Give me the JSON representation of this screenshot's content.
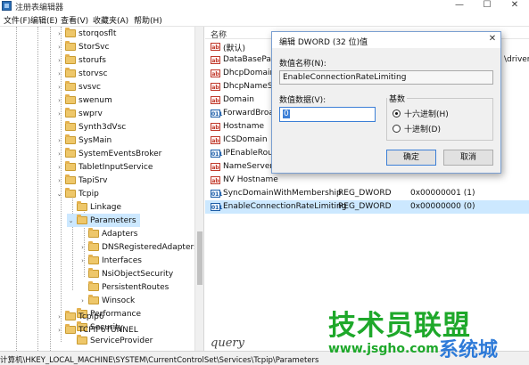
{
  "window": {
    "title": "注册表编辑器",
    "minimize": "—",
    "maximize": "☐",
    "close": "✕"
  },
  "menu": [
    "文件(F)",
    "编辑(E)",
    "查看(V)",
    "收藏夹(A)",
    "帮助(H)"
  ],
  "tree": [
    {
      "label": "storqosflt",
      "toggle": "›"
    },
    {
      "label": "StorSvc",
      "toggle": "›"
    },
    {
      "label": "storufs",
      "toggle": "›"
    },
    {
      "label": "storvsc",
      "toggle": "›"
    },
    {
      "label": "svsvc",
      "toggle": "›"
    },
    {
      "label": "swenum",
      "toggle": "›"
    },
    {
      "label": "swprv",
      "toggle": "›"
    },
    {
      "label": "Synth3dVsc",
      "toggle": ""
    },
    {
      "label": "SysMain",
      "toggle": "›"
    },
    {
      "label": "SystemEventsBroker",
      "toggle": "›"
    },
    {
      "label": "TabletInputService",
      "toggle": "›"
    },
    {
      "label": "TapiSrv",
      "toggle": "›"
    },
    {
      "label": "Tcpip",
      "toggle": "⌄"
    },
    {
      "label": "Linkage",
      "toggle": ""
    },
    {
      "label": "Parameters",
      "toggle": "⌄"
    },
    {
      "label": "Adapters",
      "toggle": ""
    },
    {
      "label": "DNSRegisteredAdapters",
      "toggle": "›"
    },
    {
      "label": "Interfaces",
      "toggle": "›"
    },
    {
      "label": "NsiObjectSecurity",
      "toggle": ""
    },
    {
      "label": "PersistentRoutes",
      "toggle": ""
    },
    {
      "label": "Winsock",
      "toggle": "›"
    },
    {
      "label": "Performance",
      "toggle": ""
    },
    {
      "label": "Security",
      "toggle": ""
    },
    {
      "label": "ServiceProvider",
      "toggle": ""
    },
    {
      "label": "Tcpip6",
      "toggle": "›"
    },
    {
      "label": "TCPIP6TUNNEL",
      "toggle": "›"
    }
  ],
  "list": {
    "columns": {
      "name": "名称"
    },
    "rows": [
      {
        "icon": "ab",
        "name": "(默认)",
        "type": "",
        "data": "",
        "tail": ""
      },
      {
        "icon": "ab",
        "name": "DataBasePath",
        "type": "",
        "data": "",
        "tail": "\\drivers'"
      },
      {
        "icon": "ab",
        "name": "DhcpDomain",
        "type": "",
        "data": "",
        "tail": ""
      },
      {
        "icon": "ab",
        "name": "DhcpNameServ",
        "type": "",
        "data": "",
        "tail": ""
      },
      {
        "icon": "ab",
        "name": "Domain",
        "type": "",
        "data": "",
        "tail": ""
      },
      {
        "icon": "dw",
        "name": "ForwardBroad",
        "type": "",
        "data": "",
        "tail": ""
      },
      {
        "icon": "ab",
        "name": "Hostname",
        "type": "",
        "data": "",
        "tail": ""
      },
      {
        "icon": "ab",
        "name": "ICSDomain",
        "type": "",
        "data": "",
        "tail": ""
      },
      {
        "icon": "dw",
        "name": "IPEnableRoute",
        "type": "",
        "data": "",
        "tail": ""
      },
      {
        "icon": "ab",
        "name": "NameServer",
        "type": "",
        "data": "",
        "tail": ""
      },
      {
        "icon": "ab",
        "name": "NV Hostname",
        "type": "",
        "data": "",
        "tail": ""
      },
      {
        "icon": "dw",
        "name": "SyncDomainWithMembership",
        "type": "REG_DWORD",
        "data": "0x00000001 (1)",
        "tail": ""
      },
      {
        "icon": "dw",
        "name": "EnableConnectionRateLimiting",
        "type": "REG_DWORD",
        "data": "0x00000000 (0)",
        "tail": ""
      }
    ]
  },
  "status": "计算机\\HKEY_LOCAL_MACHINE\\SYSTEM\\CurrentControlSet\\Services\\Tcpip\\Parameters",
  "dialog": {
    "title": "编辑 DWORD (32 位)值",
    "close": "✕",
    "name_label": "数值名称(N):",
    "name_value": "EnableConnectionRateLimiting",
    "data_label": "数值数据(V):",
    "data_value": "0",
    "base_label": "基数",
    "hex_label": "十六进制(H)",
    "dec_label": "十进制(D)",
    "selected_base": "hex",
    "ok": "确定",
    "cancel": "取消"
  },
  "overlay": {
    "handwriting": "query",
    "watermark_main": "技术员联盟",
    "watermark_url": "www.jsgho.com",
    "watermark_side": "系统城"
  }
}
